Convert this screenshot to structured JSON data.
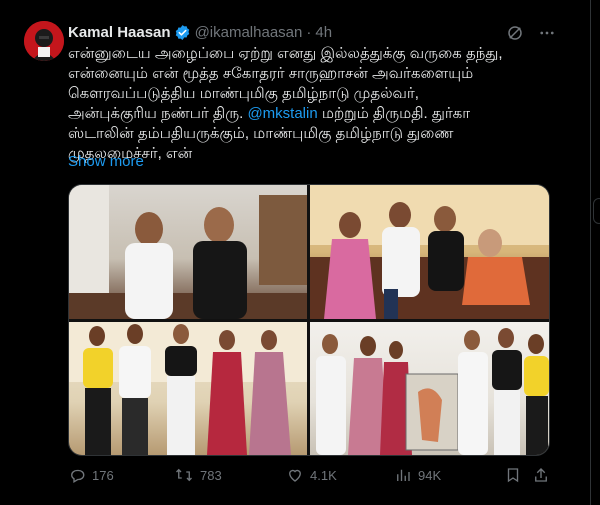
{
  "tweet": {
    "author_name": "Kamal Haasan",
    "handle": "@ikamalhaasan",
    "separator": "·",
    "time": "4h",
    "text_lines": [
      "என்னுடைய அழைப்பை ஏற்று எனது இல்லத்துக்கு வருகை தந்து,",
      "என்னையும் என் மூத்த சகோதரர் சாருஹாசன் அவர்களையும்",
      "கெளரவப்படுத்திய மாண்புமிகு தமிழ்நாடு முதல்வர்,"
    ],
    "line4_before": "அன்புக்குரிய நண்பர் திரு. ",
    "mention": "@mkstalin",
    "line4_after": " மற்றும் திருமதி. துர்கா",
    "line5": "ஸ்டாலின் தம்பதியருக்கும், மாண்புமிகு தமிழ்நாடு துணை",
    "line6": "முதலமைச்சர், என்",
    "show_more": "Show more"
  },
  "actions": {
    "replies": "176",
    "retweets": "783",
    "likes": "4.1K",
    "views": "94K"
  },
  "icons": {
    "verified": "verified-badge-icon",
    "grok": "grok-icon",
    "more": "more-icon",
    "reply": "reply-icon",
    "retweet": "retweet-icon",
    "like": "like-icon",
    "views": "views-icon",
    "bookmark": "bookmark-icon",
    "share": "share-icon"
  },
  "colors": {
    "background": "#000000",
    "text": "#e7e9ea",
    "muted": "#71767b",
    "accent": "#1d9bf0"
  }
}
